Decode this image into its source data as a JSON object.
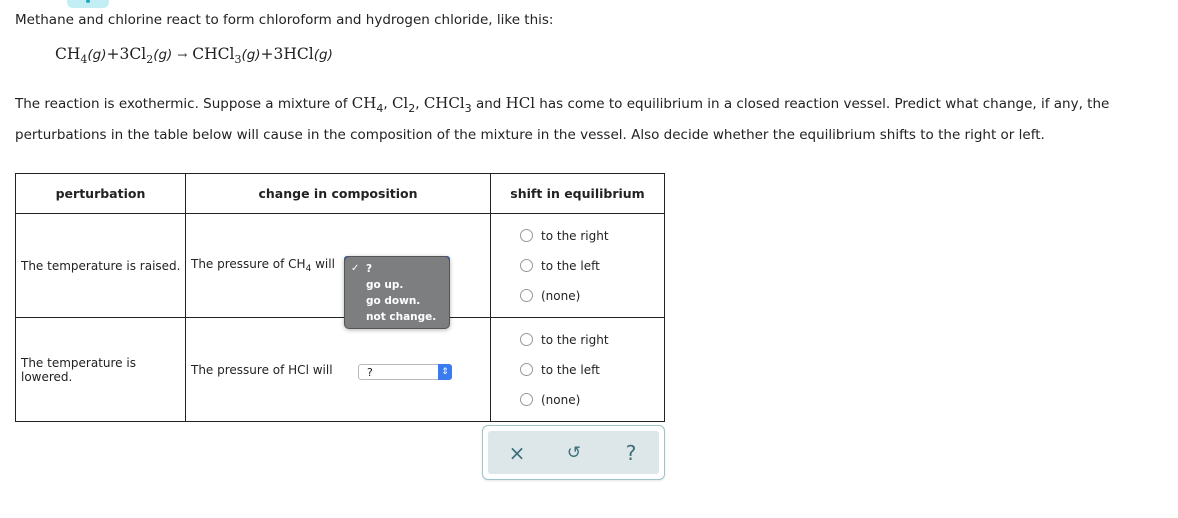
{
  "intro": "Methane and chlorine react to form chloroform and hydrogen chloride, like this:",
  "equation": {
    "r1": "CH",
    "r1_sub": "4",
    "r1_state": "(g)",
    "plus1": "+",
    "r2": "3Cl",
    "r2_sub": "2",
    "r2_state": "(g)",
    "arrow": "→",
    "p1": "CHCl",
    "p1_sub": "3",
    "p1_state": "(g)",
    "plus2": "+",
    "p2": "3HCl",
    "p2_state": "(g)"
  },
  "paragraph": {
    "part1": "The reaction is exothermic. Suppose a mixture of ",
    "s1": "CH",
    "s1_sub": "4",
    "sep1": ", ",
    "s2": "Cl",
    "s2_sub": "2",
    "sep2": ", ",
    "s3": "CHCl",
    "s3_sub": "3",
    "sep3": " and ",
    "s4": "HCl",
    "part2": " has come to equilibrium in a closed reaction vessel. Predict what change, if any, the perturbations in the table below will cause in the composition of the mixture in the vessel. Also decide whether the equilibrium shifts to the right or left."
  },
  "table": {
    "headers": [
      "perturbation",
      "change in composition",
      "shift in equilibrium"
    ],
    "rows": [
      {
        "perturbation": "The temperature is raised.",
        "composition_prefix": "The pressure of CH",
        "composition_sub": "4",
        "composition_suffix": " will",
        "select_value": "?",
        "radio_options": [
          "to the right",
          "to the left",
          "(none)"
        ]
      },
      {
        "perturbation": "The temperature is lowered.",
        "composition_prefix": "The pressure of HCl will",
        "select_value": "?",
        "radio_options": [
          "to the right",
          "to the left",
          "(none)"
        ]
      }
    ]
  },
  "dropdown": {
    "checkmark": "✓",
    "options": [
      "?",
      "go up.",
      "go down.",
      "not change."
    ],
    "selected": "?"
  },
  "toolbar": {
    "close_label": "×",
    "undo_label": "↺",
    "help_label": "?"
  },
  "select_arrows": "⇕"
}
